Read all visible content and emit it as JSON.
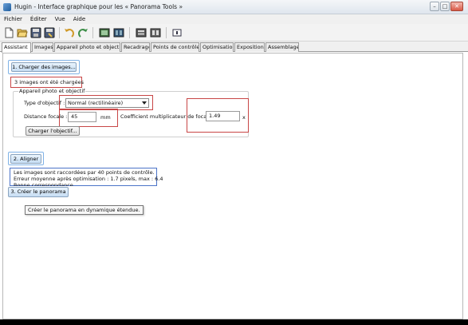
{
  "window": {
    "title": "Hugin - Interface graphique pour les « Panorama Tools »",
    "controls": {
      "minimize": "–",
      "maximize": "□",
      "close": "✕"
    }
  },
  "menu": [
    "Fichier",
    "Éditer",
    "Vue",
    "Aide"
  ],
  "toolbar": {
    "icons": [
      "new-icon",
      "open-icon",
      "save-icon",
      "save-as-icon",
      "undo-icon",
      "redo-icon",
      "add-images-icon",
      "stitch-icon",
      "preview-icon",
      "fast-preview-icon",
      "info-icon"
    ]
  },
  "tabs": [
    {
      "label": "Assistant",
      "active": true
    },
    {
      "label": "Images",
      "active": false
    },
    {
      "label": "Appareil photo et objectif",
      "active": false
    },
    {
      "label": "Recadrage",
      "active": false
    },
    {
      "label": "Points de contrôle",
      "active": false
    },
    {
      "label": "Optimisation",
      "active": false
    },
    {
      "label": "Exposition",
      "active": false
    },
    {
      "label": "Assemblage",
      "active": false
    }
  ],
  "assistant": {
    "load_images_button": "1. Charger des images...",
    "images_loaded_status": "3 images ont été chargées",
    "camera_group_label": "Appareil photo et objectif",
    "lens_type_label": "Type d'objectif :",
    "lens_type_value": "Normal (rectilinéaire)",
    "focal_length_label": "Distance focale :",
    "focal_length_value": "45",
    "focal_length_unit": "mm",
    "crop_factor_label": "Coefficient multiplicateur de focale :",
    "crop_factor_value": "1.49",
    "crop_factor_unit": "x",
    "load_lens_button": "Charger l'objectif...",
    "align_button": "2. Aligner",
    "align_status_line1": "Les images sont raccordées par 40 points de contrôle.",
    "align_status_line2": "Erreur moyenne après optimisation : 1.7 pixels, max : 6.4",
    "align_status_line3": "Bonne correspondance",
    "create_panorama_button": "3. Créer le panorama",
    "tooltip": "Créer le panorama en dynamique étendue."
  },
  "colors": {
    "annotation_red": "#c84646",
    "annotation_blue": "#4c74c8",
    "button_blue": "#c6ddf3"
  }
}
